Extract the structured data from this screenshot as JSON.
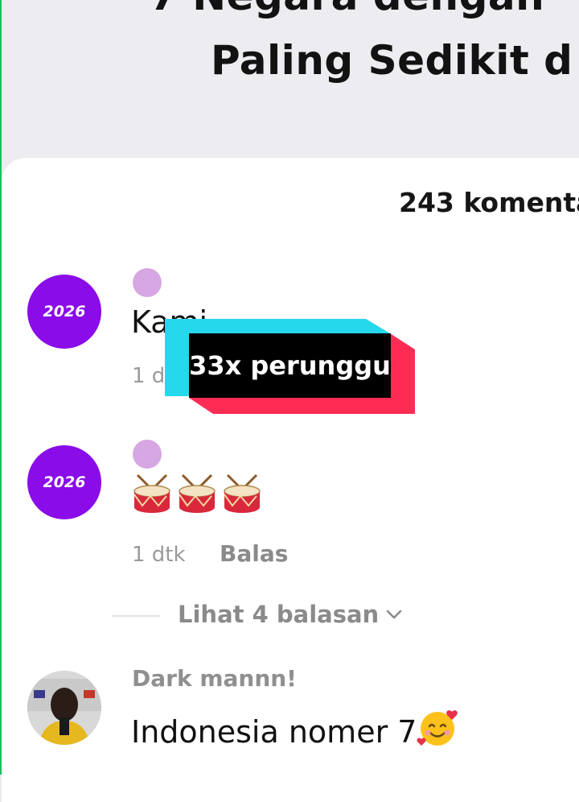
{
  "header": {
    "title_line1": "7 Negara dengan",
    "title_line2": "Paling Sedikit d"
  },
  "comments_count": "243 komenta",
  "comments": [
    {
      "avatar_text": "2026",
      "text": "Kami",
      "time": "1 d"
    },
    {
      "avatar_text": "2026",
      "emojis": [
        "drum-icon",
        "drum-icon",
        "drum-icon"
      ],
      "time": "1 dtk",
      "reply_label": "Balas",
      "view_replies": "Lihat 4 balasan"
    },
    {
      "username": "Dark mannn!",
      "text": "Indonesia nomer 7",
      "emoji": "smiling-face-with-hearts-icon"
    }
  ],
  "overlay_caption": "33x perunggu",
  "colors": {
    "avatar_purple": "#8a0ce8",
    "badge_dot": "#d7a7e3",
    "caption_cyan": "#25d8ec",
    "caption_red": "#fe2c55",
    "edge_green": "#19c15a"
  }
}
